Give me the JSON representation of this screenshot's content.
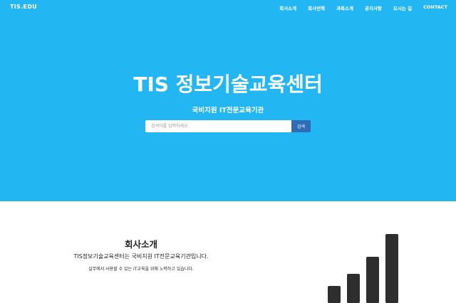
{
  "header": {
    "brand": "TIS.EDU",
    "nav": [
      "회사소개",
      "회사연혁",
      "과목소개",
      "공지사항",
      "오시는 길",
      "CONTACT"
    ]
  },
  "hero": {
    "title": "TIS 정보기술교육센터",
    "subtitle": "국비지원 IT전문교육기관",
    "search_placeholder": "검색어를 입력하세요.",
    "search_button": "검색"
  },
  "about": {
    "title": "회사소개",
    "line1": "TIS정보기술교육센터는 국비지원 IT전문교육기관입니다.",
    "line2": "실무에서 사용할 수 있는 IT교육을 위해 노력하고 있습니다.",
    "icon": "signal-bars-icon"
  },
  "colors": {
    "hero_bg": "#22b6f2",
    "search_button_bg": "#2e6cb6",
    "icon_color": "#2e2e2e"
  }
}
